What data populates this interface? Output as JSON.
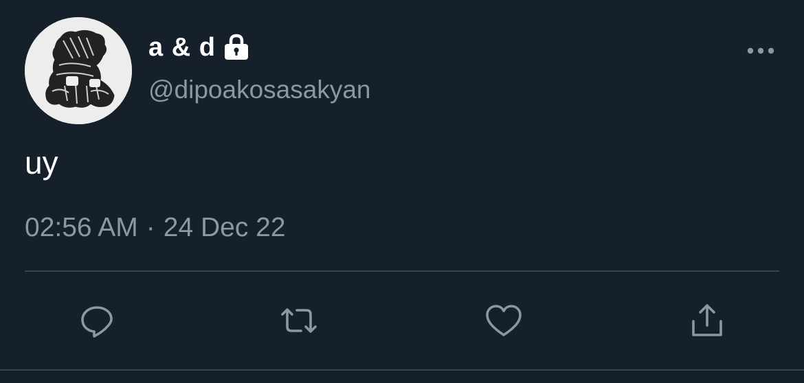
{
  "author": {
    "display_name": "a & d",
    "handle": "@dipoakosasakyan",
    "protected": true
  },
  "tweet": {
    "text": "uy",
    "time": "02:56 AM",
    "separator": "·",
    "date": "24 Dec 22"
  },
  "icons": {
    "avatar": "avatar-image",
    "lock": "lock-icon",
    "more": "more-options-icon",
    "reply": "reply-icon",
    "retweet": "retweet-icon",
    "like": "heart-icon",
    "share": "share-icon"
  },
  "colors": {
    "background": "#15202b",
    "primary_text": "#ffffff",
    "secondary_text": "#8899a6",
    "divider": "#38444d"
  }
}
